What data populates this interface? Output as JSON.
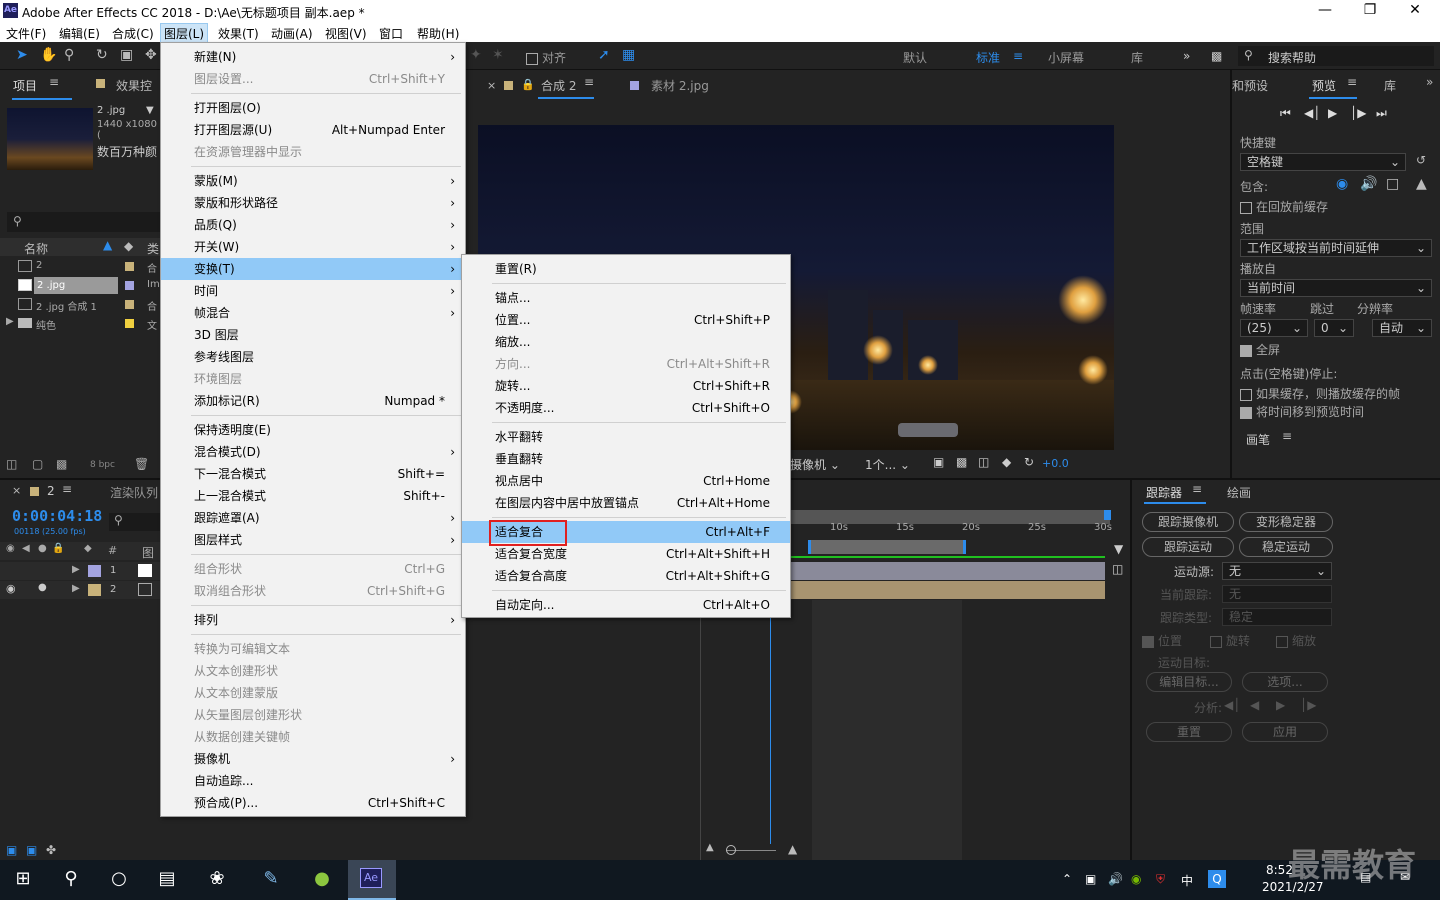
{
  "window": {
    "title": "Adobe After Effects CC 2018 - D:\\Ae\\无标题项目 副本.aep *",
    "app_icon": "Ae"
  },
  "menubar": [
    "文件(F)",
    "编辑(E)",
    "合成(C)",
    "图层(L)",
    "效果(T)",
    "动画(A)",
    "视图(V)",
    "窗口",
    "帮助(H)"
  ],
  "toolbar": {
    "snap_label": "对齐",
    "workspaces": [
      "默认",
      "标准",
      "小屏幕",
      "库"
    ],
    "search_placeholder": "搜索帮助"
  },
  "project": {
    "tab": "项目",
    "effects_tab": "效果控",
    "item_name": "2 .jpg",
    "item_size": "1440 x1080 (",
    "item_desc": "数百万种颜",
    "col_name": "名称",
    "col_type": "类",
    "rows": [
      {
        "name": "2",
        "type": "合"
      },
      {
        "name": "2 .jpg",
        "type": "Im"
      },
      {
        "name": "2 .jpg 合成 1",
        "type": "合"
      },
      {
        "name": "纯色",
        "type": "文"
      }
    ],
    "bpc": "8 bpc"
  },
  "comp": {
    "tab_label": "合成 2",
    "footage_tab": "素材 2.jpg",
    "camera": "摄像机",
    "views": "1个...",
    "exposure": "+0.0"
  },
  "timeline": {
    "comp_name": "2",
    "render_queue": "渲染队列",
    "timecode": "0:00:04:18",
    "frames": "00118 (25.00 fps)",
    "col_hash": "#",
    "col_layer": "图",
    "ruler": [
      "10s",
      "15s",
      "20s",
      "25s",
      "30s"
    ],
    "layers": [
      {
        "num": "1"
      },
      {
        "num": "2"
      }
    ]
  },
  "preview": {
    "tab_presets": "和预设",
    "tab_preview": "预览",
    "tab_lib": "库",
    "shortcut_label": "快捷键",
    "shortcut_value": "空格键",
    "include": "包含:",
    "cache_before": "在回放前缓存",
    "range_label": "范围",
    "range_value": "工作区域按当前时间延伸",
    "play_from_label": "播放自",
    "play_from_value": "当前时间",
    "fps_label": "帧速率",
    "skip_label": "跳过",
    "res_label": "分辨率",
    "fps_value": "(25)",
    "skip_value": "0",
    "res_value": "自动",
    "fullscreen": "全屏",
    "stop_label": "点击(空格键)停止:",
    "if_cache": "如果缓存，则播放缓存的帧",
    "move_time": "将时间移到预览时间",
    "brush_tab": "画笔"
  },
  "tracker": {
    "tab": "跟踪器",
    "paint_tab": "绘画",
    "track_camera": "跟踪摄像机",
    "warp_stabilize": "变形稳定器",
    "track_motion": "跟踪运动",
    "stabilize_motion": "稳定运动",
    "motion_source_label": "运动源:",
    "motion_source_value": "无",
    "current_track_label": "当前跟踪:",
    "current_track_value": "无",
    "track_type_label": "跟踪类型:",
    "track_type_value": "稳定",
    "position": "位置",
    "rotation": "旋转",
    "scale": "缩放",
    "motion_target": "运动目标:",
    "edit_target": "编辑目标...",
    "options": "选项...",
    "analyze": "分析:",
    "reset": "重置",
    "apply": "应用"
  },
  "layer_menu": [
    {
      "label": "新建(N)",
      "shortcut": "",
      "arrow": true,
      "disabled": false
    },
    {
      "label": "图层设置...",
      "shortcut": "Ctrl+Shift+Y",
      "arrow": false,
      "disabled": true
    },
    {
      "sep": true
    },
    {
      "label": "打开图层(O)",
      "shortcut": "",
      "arrow": false,
      "disabled": false
    },
    {
      "label": "打开图层源(U)",
      "shortcut": "Alt+Numpad Enter",
      "arrow": false,
      "disabled": false
    },
    {
      "label": "在资源管理器中显示",
      "shortcut": "",
      "arrow": false,
      "disabled": true
    },
    {
      "sep": true
    },
    {
      "label": "蒙版(M)",
      "shortcut": "",
      "arrow": true,
      "disabled": false
    },
    {
      "label": "蒙版和形状路径",
      "shortcut": "",
      "arrow": true,
      "disabled": false
    },
    {
      "label": "品质(Q)",
      "shortcut": "",
      "arrow": true,
      "disabled": false
    },
    {
      "label": "开关(W)",
      "shortcut": "",
      "arrow": true,
      "disabled": false
    },
    {
      "label": "变换(T)",
      "shortcut": "",
      "arrow": true,
      "disabled": false,
      "highlight": true
    },
    {
      "label": "时间",
      "shortcut": "",
      "arrow": true,
      "disabled": false
    },
    {
      "label": "帧混合",
      "shortcut": "",
      "arrow": true,
      "disabled": false
    },
    {
      "label": "3D 图层",
      "shortcut": "",
      "arrow": false,
      "disabled": false
    },
    {
      "label": "参考线图层",
      "shortcut": "",
      "arrow": false,
      "disabled": false
    },
    {
      "label": "环境图层",
      "shortcut": "",
      "arrow": false,
      "disabled": true
    },
    {
      "label": "添加标记(R)",
      "shortcut": "Numpad *",
      "arrow": false,
      "disabled": false
    },
    {
      "sep": true
    },
    {
      "label": "保持透明度(E)",
      "shortcut": "",
      "arrow": false,
      "disabled": false
    },
    {
      "label": "混合模式(D)",
      "shortcut": "",
      "arrow": true,
      "disabled": false
    },
    {
      "label": "下一混合模式",
      "shortcut": "Shift+=",
      "arrow": false,
      "disabled": false
    },
    {
      "label": "上一混合模式",
      "shortcut": "Shift+-",
      "arrow": false,
      "disabled": false
    },
    {
      "label": "跟踪遮罩(A)",
      "shortcut": "",
      "arrow": true,
      "disabled": false
    },
    {
      "label": "图层样式",
      "shortcut": "",
      "arrow": true,
      "disabled": false
    },
    {
      "sep": true
    },
    {
      "label": "组合形状",
      "shortcut": "Ctrl+G",
      "arrow": false,
      "disabled": true
    },
    {
      "label": "取消组合形状",
      "shortcut": "Ctrl+Shift+G",
      "arrow": false,
      "disabled": true
    },
    {
      "sep": true
    },
    {
      "label": "排列",
      "shortcut": "",
      "arrow": true,
      "disabled": false
    },
    {
      "sep": true
    },
    {
      "label": "转换为可编辑文本",
      "shortcut": "",
      "arrow": false,
      "disabled": true
    },
    {
      "label": "从文本创建形状",
      "shortcut": "",
      "arrow": false,
      "disabled": true
    },
    {
      "label": "从文本创建蒙版",
      "shortcut": "",
      "arrow": false,
      "disabled": true
    },
    {
      "label": "从矢量图层创建形状",
      "shortcut": "",
      "arrow": false,
      "disabled": true
    },
    {
      "label": "从数据创建关键帧",
      "shortcut": "",
      "arrow": false,
      "disabled": true
    },
    {
      "label": "摄像机",
      "shortcut": "",
      "arrow": true,
      "disabled": false
    },
    {
      "label": "自动追踪...",
      "shortcut": "",
      "arrow": false,
      "disabled": false
    },
    {
      "label": "预合成(P)...",
      "shortcut": "Ctrl+Shift+C",
      "arrow": false,
      "disabled": false
    }
  ],
  "transform_menu": [
    {
      "label": "重置(R)",
      "shortcut": "",
      "disabled": false
    },
    {
      "sep": true
    },
    {
      "label": "锚点...",
      "shortcut": "",
      "disabled": false
    },
    {
      "label": "位置...",
      "shortcut": "Ctrl+Shift+P",
      "disabled": false
    },
    {
      "label": "缩放...",
      "shortcut": "",
      "disabled": false
    },
    {
      "label": "方向...",
      "shortcut": "Ctrl+Alt+Shift+R",
      "disabled": true
    },
    {
      "label": "旋转...",
      "shortcut": "Ctrl+Shift+R",
      "disabled": false
    },
    {
      "label": "不透明度...",
      "shortcut": "Ctrl+Shift+O",
      "disabled": false
    },
    {
      "sep": true
    },
    {
      "label": "水平翻转",
      "shortcut": "",
      "disabled": false
    },
    {
      "label": "垂直翻转",
      "shortcut": "",
      "disabled": false
    },
    {
      "label": "视点居中",
      "shortcut": "Ctrl+Home",
      "disabled": false
    },
    {
      "label": "在图层内容中居中放置锚点",
      "shortcut": "Ctrl+Alt+Home",
      "disabled": false
    },
    {
      "sep": true
    },
    {
      "label": "适合复合",
      "shortcut": "Ctrl+Alt+F",
      "disabled": false,
      "highlight": true,
      "boxed": true
    },
    {
      "label": "适合复合宽度",
      "shortcut": "Ctrl+Alt+Shift+H",
      "disabled": false
    },
    {
      "label": "适合复合高度",
      "shortcut": "Ctrl+Alt+Shift+G",
      "disabled": false
    },
    {
      "sep": true
    },
    {
      "label": "自动定向...",
      "shortcut": "Ctrl+Alt+O",
      "disabled": false
    }
  ],
  "taskbar": {
    "time": "8:52",
    "date": "2021/2/27",
    "ime": "中",
    "ae_label": "Ae"
  },
  "watermark": "最需教育",
  "colors": {
    "menu_highlight": "#91c9f7",
    "accent_blue": "#2d8ceb",
    "timecode": "#2d8ceb",
    "red_box": "#e02020"
  }
}
